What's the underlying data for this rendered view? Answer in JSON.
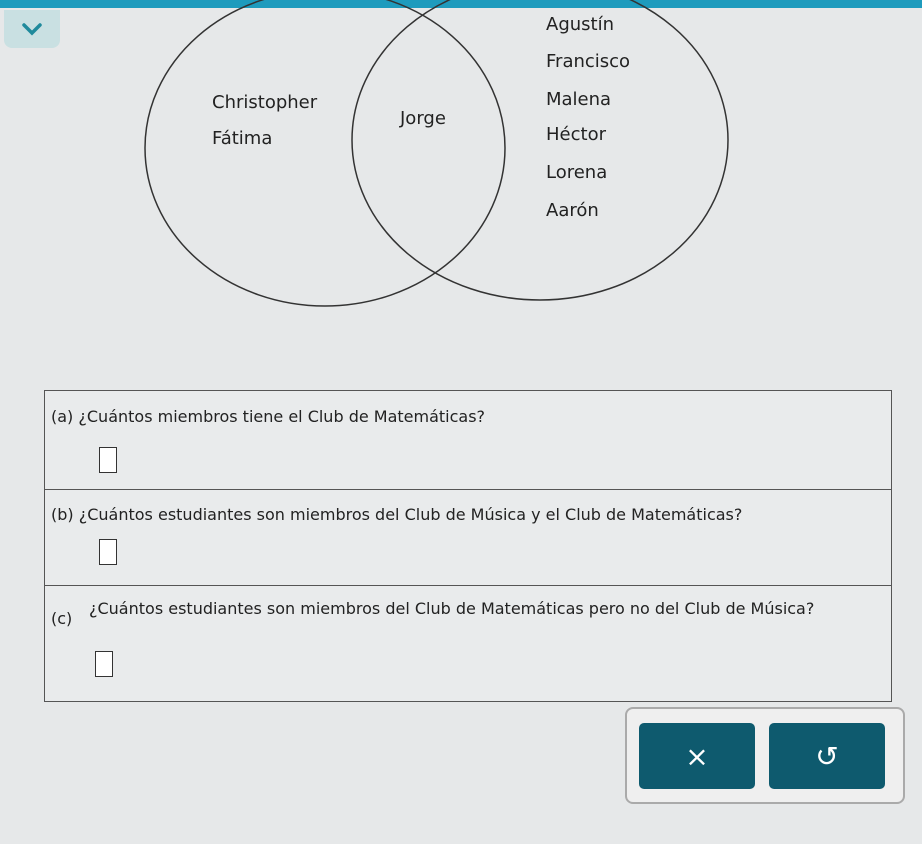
{
  "venn": {
    "left_only": [
      "Christopher",
      "Fátima"
    ],
    "both": [
      "Jorge"
    ],
    "right_only": [
      "Agustín",
      "Francisco",
      "Malena",
      "Héctor",
      "Lorena",
      "Aarón"
    ]
  },
  "questions": [
    {
      "label": "(a)",
      "text": "¿Cuántos miembros tiene el Club de Matemáticas?",
      "answer": ""
    },
    {
      "label": "(b)",
      "text": "¿Cuántos estudiantes son miembros del Club de Música y el Club de Matemáticas?",
      "answer": ""
    },
    {
      "label": "(c)",
      "text": "¿Cuántos estudiantes son miembros del Club de Matemáticas pero no del Club de Música?",
      "answer": ""
    }
  ],
  "buttons": {
    "clear_icon": "×",
    "undo_icon": "↺"
  },
  "colors": {
    "accent": "#1e9bbd",
    "button": "#0e5a6e"
  }
}
